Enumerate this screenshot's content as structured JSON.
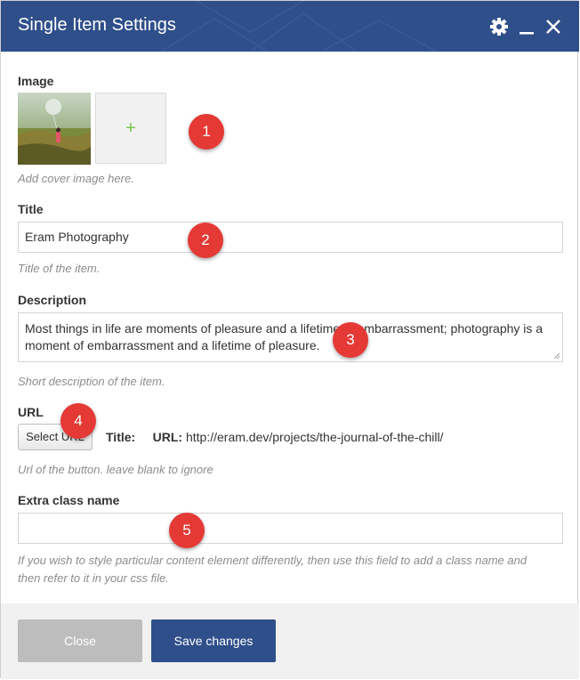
{
  "header": {
    "title": "Single Item Settings"
  },
  "fields": {
    "image": {
      "label": "Image",
      "add_symbol": "+",
      "help": "Add cover image here."
    },
    "title": {
      "label": "Title",
      "value": "Eram Photography",
      "help": "Title of the item."
    },
    "description": {
      "label": "Description",
      "value": "Most things in life are moments of pleasure and a lifetime of embarrassment; photography is a moment of embarrassment and a lifetime of pleasure.",
      "help": "Short description of the item."
    },
    "url": {
      "label": "URL",
      "button_label": "Select URL",
      "title_label": "Title:",
      "url_label": "URL:",
      "url_value": "http://eram.dev/projects/the-journal-of-the-chill/",
      "help": "Url of the button. leave blank to ignore"
    },
    "extra_class": {
      "label": "Extra class name",
      "value": "",
      "help": "If you wish to style particular content element differently, then use this field to add a class name and then refer to it in your css file."
    }
  },
  "badges": [
    "1",
    "2",
    "3",
    "4",
    "5"
  ],
  "footer": {
    "close_label": "Close",
    "save_label": "Save changes"
  },
  "colors": {
    "header_bg": "#2f4f8a",
    "save_bg": "#2f4f8a",
    "close_bg": "#bdbdbd",
    "badge": "#e53935",
    "add_plus": "#7bc44b"
  },
  "icons": {
    "settings": "gear-icon",
    "minimize": "minimize-icon",
    "close": "close-icon",
    "add": "plus-icon"
  }
}
